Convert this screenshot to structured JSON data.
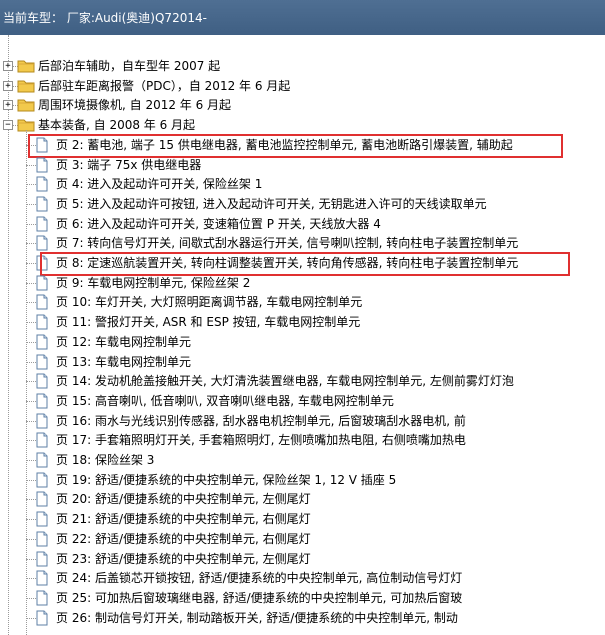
{
  "header": {
    "title": "当前车型：  厂家:Audi(奥迪)Q72014-"
  },
  "folders": [
    {
      "label": "后部泊车辅助，自车型年 2007 起",
      "expanded": false
    },
    {
      "label": "后部驻车距离报警（PDC），自 2012 年 6 月起",
      "expanded": false
    },
    {
      "label": "周围环境摄像机, 自 2012 年 6 月起",
      "expanded": false
    },
    {
      "label": "基本装备, 自 2008 年 6 月起",
      "expanded": true
    }
  ],
  "pages": [
    {
      "label": "页 2:  蓄电池, 端子 15 供电继电器, 蓄电池监控控制单元, 蓄电池断路引爆装置, 辅助起",
      "highlighted": true
    },
    {
      "label": "页 3:  端子 75x 供电继电器",
      "highlighted": false
    },
    {
      "label": "页 4:  进入及起动许可开关, 保险丝架 1",
      "highlighted": false
    },
    {
      "label": "页 5:  进入及起动许可按钮, 进入及起动许可开关, 无钥匙进入许可的天线读取单元",
      "highlighted": false
    },
    {
      "label": "页 6:  进入及起动许可开关, 变速箱位置 P 开关, 天线放大器 4",
      "highlighted": false
    },
    {
      "label": "页 7:  转向信号灯开关, 间歇式刮水器运行开关, 信号喇叭控制, 转向柱电子装置控制单元",
      "highlighted": false
    },
    {
      "label": "页 8:  定速巡航装置开关, 转向柱调整装置开关, 转向角传感器, 转向柱电子装置控制单元",
      "highlighted": true
    },
    {
      "label": "页 9:  车载电网控制单元, 保险丝架 2",
      "highlighted": false
    },
    {
      "label": "页 10:  车灯开关, 大灯照明距离调节器, 车载电网控制单元",
      "highlighted": false
    },
    {
      "label": "页 11:  警报灯开关, ASR 和 ESP 按钮, 车载电网控制单元",
      "highlighted": false
    },
    {
      "label": "页 12:  车载电网控制单元",
      "highlighted": false
    },
    {
      "label": "页 13:  车载电网控制单元",
      "highlighted": false
    },
    {
      "label": "页 14:  发动机舱盖接触开关, 大灯清洗装置继电器, 车载电网控制单元, 左侧前雾灯灯泡",
      "highlighted": false
    },
    {
      "label": "页 15:  高音喇叭, 低音喇叭, 双音喇叭继电器, 车载电网控制单元",
      "highlighted": false
    },
    {
      "label": "页 16:  雨水与光线识别传感器, 刮水器电机控制单元, 后窗玻璃刮水器电机, 前",
      "highlighted": false
    },
    {
      "label": "页 17:  手套箱照明灯开关, 手套箱照明灯, 左侧喷嘴加热电阻, 右侧喷嘴加热电",
      "highlighted": false
    },
    {
      "label": "页 18:  保险丝架 3",
      "highlighted": false
    },
    {
      "label": "页 19:  舒适/便捷系统的中央控制单元, 保险丝架 1, 12 V 插座 5",
      "highlighted": false
    },
    {
      "label": "页 20:  舒适/便捷系统的中央控制单元, 左侧尾灯",
      "highlighted": false
    },
    {
      "label": "页 21:  舒适/便捷系统的中央控制单元, 右侧尾灯",
      "highlighted": false
    },
    {
      "label": "页 22:  舒适/便捷系统的中央控制单元, 右侧尾灯",
      "highlighted": false
    },
    {
      "label": "页 23:  舒适/便捷系统的中央控制单元, 左侧尾灯",
      "highlighted": false
    },
    {
      "label": "页 24:  后盖锁芯开锁按钮, 舒适/便捷系统的中央控制单元, 高位制动信号灯灯",
      "highlighted": false
    },
    {
      "label": "页 25:  可加热后窗玻璃继电器, 舒适/便捷系统的中央控制单元, 可加热后窗玻",
      "highlighted": false
    },
    {
      "label": "页 26:  制动信号灯开关, 制动踏板开关, 舒适/便捷系统的中央控制单元, 制动",
      "highlighted": false
    }
  ],
  "icons": {
    "folder": "folder-icon",
    "page": "document-icon",
    "expand": "plus-icon",
    "collapse": "minus-icon"
  },
  "colors": {
    "header": "#4a6a8e",
    "highlight": "#e03030",
    "folder": "#f2c94c"
  }
}
